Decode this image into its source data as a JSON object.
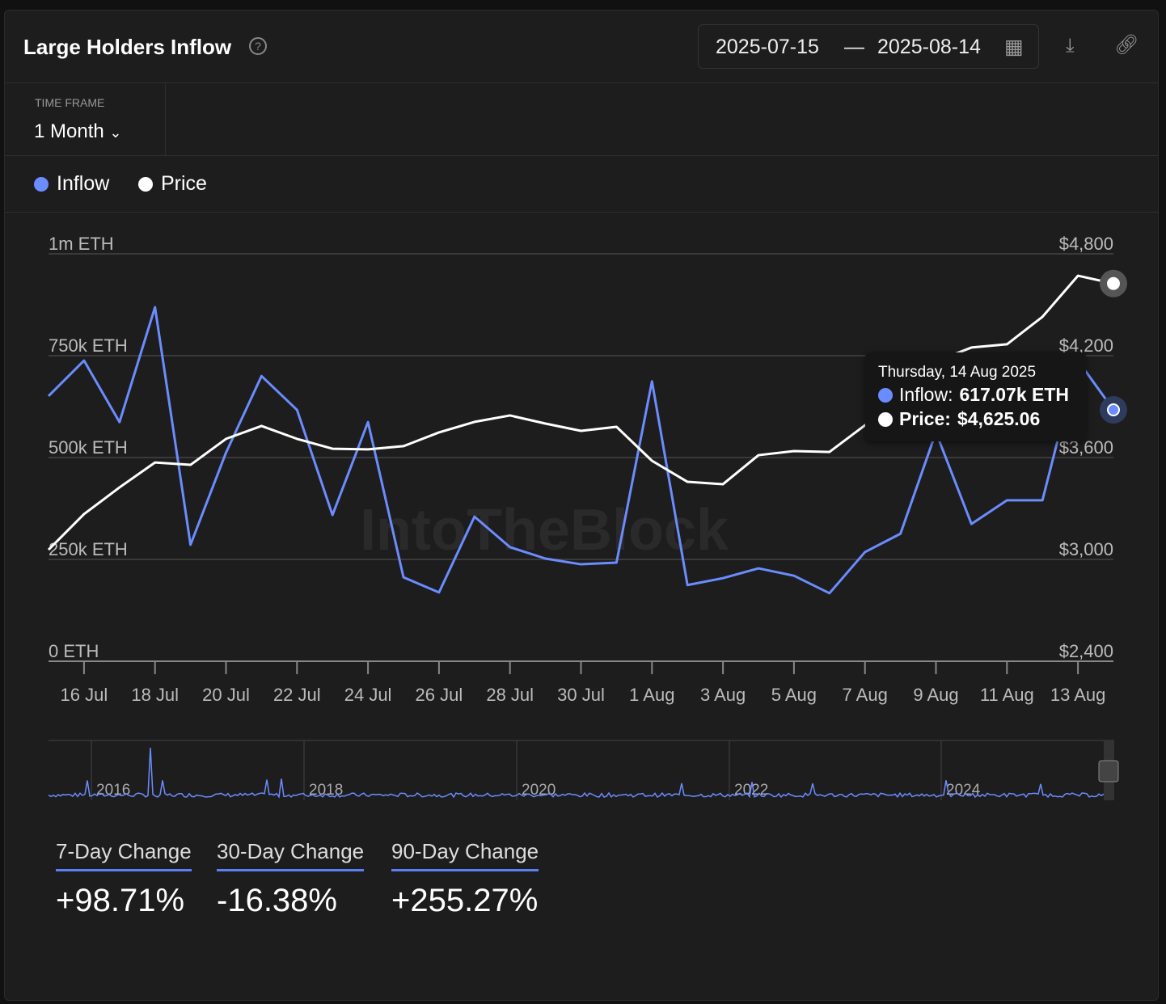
{
  "header": {
    "title": "Large Holders Inflow",
    "date_start": "2025-07-15",
    "date_sep": "—",
    "date_end": "2025-08-14"
  },
  "timeframe": {
    "label": "TIME FRAME",
    "value": "1 Month"
  },
  "legend": [
    {
      "name": "Inflow",
      "color": "#6b8cff"
    },
    {
      "name": "Price",
      "color": "#ffffff"
    }
  ],
  "watermark": "IntoTheBlock",
  "tooltip": {
    "date": "Thursday, 14 Aug 2025",
    "inflow_label": "Inflow:",
    "inflow_value": "617.07k ETH",
    "price_label": "Price:",
    "price_value": "$4,625.06"
  },
  "chart_data": {
    "type": "line",
    "x": [
      "15 Jul",
      "16 Jul",
      "17 Jul",
      "18 Jul",
      "19 Jul",
      "20 Jul",
      "21 Jul",
      "22 Jul",
      "23 Jul",
      "24 Jul",
      "25 Jul",
      "26 Jul",
      "27 Jul",
      "28 Jul",
      "29 Jul",
      "30 Jul",
      "31 Jul",
      "1 Aug",
      "2 Aug",
      "3 Aug",
      "4 Aug",
      "5 Aug",
      "6 Aug",
      "7 Aug",
      "8 Aug",
      "9 Aug",
      "10 Aug",
      "11 Aug",
      "12 Aug",
      "13 Aug",
      "14 Aug"
    ],
    "x_ticks": [
      "16 Jul",
      "18 Jul",
      "20 Jul",
      "22 Jul",
      "24 Jul",
      "26 Jul",
      "28 Jul",
      "30 Jul",
      "1 Aug",
      "3 Aug",
      "5 Aug",
      "7 Aug",
      "9 Aug",
      "11 Aug",
      "13 Aug"
    ],
    "y_left": {
      "ticks": [
        "0 ETH",
        "250k ETH",
        "500k ETH",
        "750k ETH",
        "1m ETH"
      ],
      "range": [
        0,
        1000000
      ]
    },
    "y_right": {
      "ticks": [
        "$2,400",
        "$3,000",
        "$3,600",
        "$4,200",
        "$4,800"
      ],
      "range": [
        2400,
        4800
      ]
    },
    "grid": true,
    "series": [
      {
        "name": "Inflow",
        "axis": "left",
        "color": "#6b8cff",
        "values": [
          651000,
          738000,
          587000,
          869000,
          286000,
          512000,
          700000,
          617000,
          359000,
          587000,
          206000,
          169000,
          355000,
          280000,
          252000,
          238000,
          242000,
          687000,
          187000,
          204000,
          228000,
          210000,
          167000,
          268000,
          313000,
          562000,
          337000,
          395000,
          395000,
          738000,
          617070
        ]
      },
      {
        "name": "Price",
        "axis": "right",
        "color": "#ffffff",
        "values": [
          3057,
          3267,
          3424,
          3571,
          3557,
          3710,
          3786,
          3710,
          3652,
          3648,
          3667,
          3748,
          3810,
          3848,
          3800,
          3757,
          3781,
          3581,
          3457,
          3443,
          3614,
          3638,
          3633,
          3790,
          3914,
          4167,
          4248,
          4267,
          4429,
          4671,
          4625.06
        ]
      }
    ],
    "navigator": {
      "x_ticks": [
        "2016",
        "2018",
        "2020",
        "2022",
        "2024"
      ]
    }
  },
  "stats": [
    {
      "label": "7-Day Change",
      "value": "+98.71%"
    },
    {
      "label": "30-Day Change",
      "value": "-16.38%"
    },
    {
      "label": "90-Day Change",
      "value": "+255.27%"
    }
  ]
}
